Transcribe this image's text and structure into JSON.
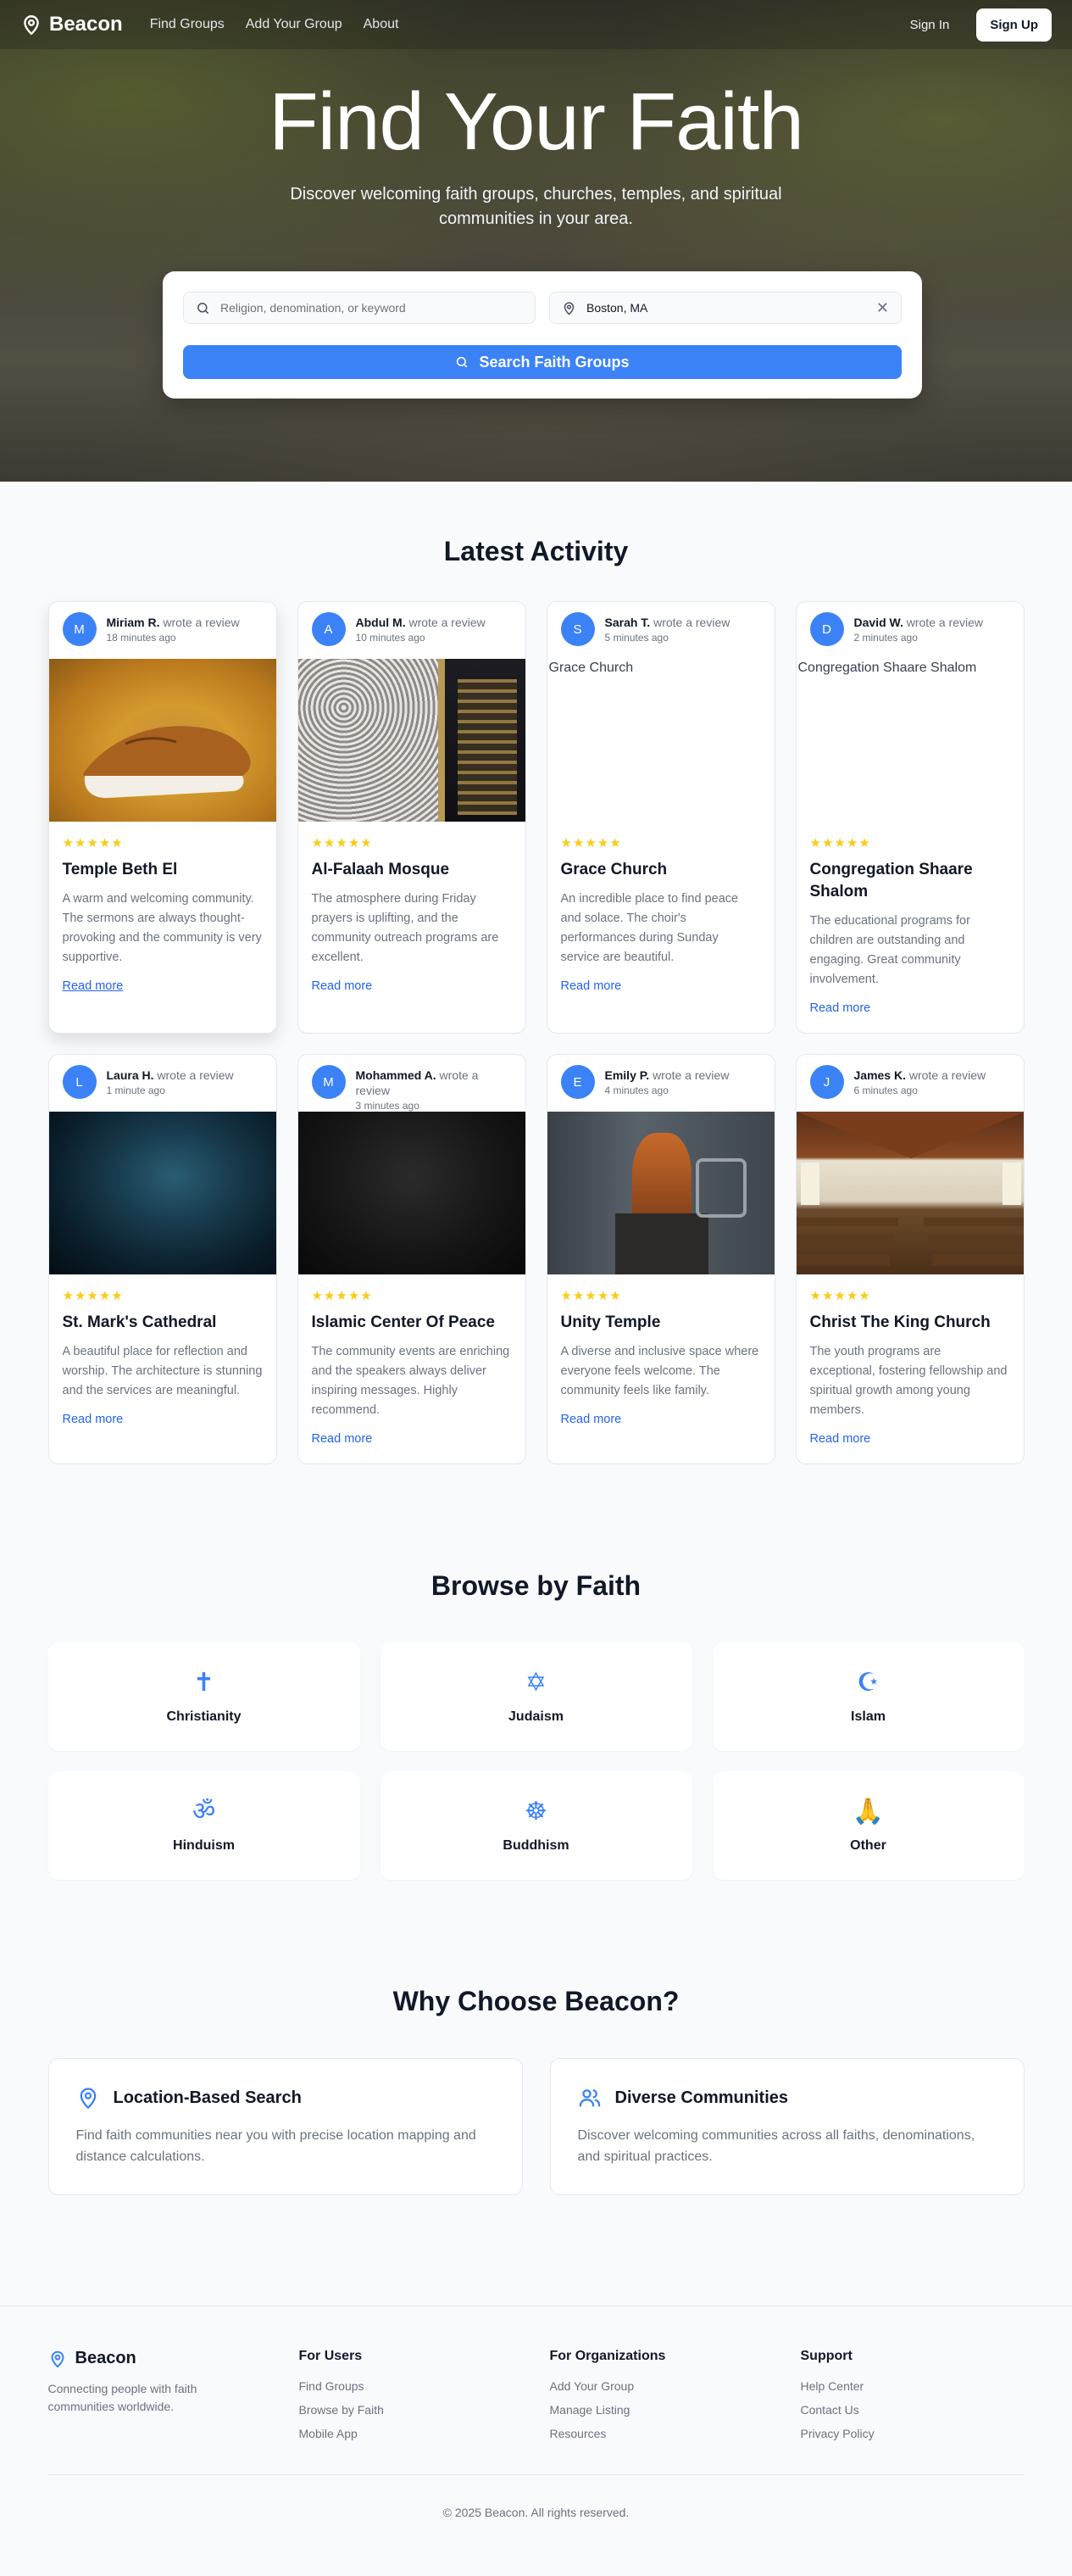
{
  "nav": {
    "brand": "Beacon",
    "links": [
      "Find Groups",
      "Add Your Group",
      "About"
    ],
    "sign_in": "Sign In",
    "sign_up": "Sign Up"
  },
  "hero": {
    "title": "Find Your Faith",
    "subtitle": "Discover welcoming faith groups, churches, temples, and spiritual communities in your area.",
    "keyword_placeholder": "Religion, denomination, or keyword",
    "location_value": "Boston, MA",
    "search_button": "Search Faith Groups"
  },
  "activity": {
    "title": "Latest Activity",
    "cards": [
      {
        "initial": "M",
        "user": "Miriam R.",
        "action": "wrote a review",
        "time": "18 minutes ago",
        "stars": "★★★★★",
        "name": "Temple Beth El",
        "text": "A warm and welcoming community. The sermons are always thought-provoking and the community is very supportive.",
        "link": "Read more",
        "img_alt": ""
      },
      {
        "initial": "A",
        "user": "Abdul M.",
        "action": "wrote a review",
        "time": "10 minutes ago",
        "stars": "★★★★★",
        "name": "Al-Falaah Mosque",
        "text": "The atmosphere during Friday prayers is uplifting, and the community outreach programs are excellent.",
        "link": "Read more",
        "img_alt": ""
      },
      {
        "initial": "S",
        "user": "Sarah T.",
        "action": "wrote a review",
        "time": "5 minutes ago",
        "stars": "★★★★★",
        "name": "Grace Church",
        "text": "An incredible place to find peace and solace. The choir's performances during Sunday service are beautiful.",
        "link": "Read more",
        "img_alt": "Grace Church"
      },
      {
        "initial": "D",
        "user": "David W.",
        "action": "wrote a review",
        "time": "2 minutes ago",
        "stars": "★★★★★",
        "name": "Congregation Shaare Shalom",
        "text": "The educational programs for children are outstanding and engaging. Great community involvement.",
        "link": "Read more",
        "img_alt": "Congregation Shaare Shalom"
      },
      {
        "initial": "L",
        "user": "Laura H.",
        "action": "wrote a review",
        "time": "1 minute ago",
        "stars": "★★★★★",
        "name": "St. Mark's Cathedral",
        "text": "A beautiful place for reflection and worship. The architecture is stunning and the services are meaningful.",
        "link": "Read more",
        "img_alt": ""
      },
      {
        "initial": "M",
        "user": "Mohammed A.",
        "action": "wrote a review",
        "time": "3 minutes ago",
        "stars": "★★★★★",
        "name": "Islamic Center Of Peace",
        "text": "The community events are enriching and the speakers always deliver inspiring messages. Highly recommend.",
        "link": "Read more",
        "img_alt": ""
      },
      {
        "initial": "E",
        "user": "Emily P.",
        "action": "wrote a review",
        "time": "4 minutes ago",
        "stars": "★★★★★",
        "name": "Unity Temple",
        "text": "A diverse and inclusive space where everyone feels welcome. The community feels like family.",
        "link": "Read more",
        "img_alt": ""
      },
      {
        "initial": "J",
        "user": "James K.",
        "action": "wrote a review",
        "time": "6 minutes ago",
        "stars": "★★★★★",
        "name": "Christ The King Church",
        "text": "The youth programs are exceptional, fostering fellowship and spiritual growth among young members.",
        "link": "Read more",
        "img_alt": ""
      }
    ]
  },
  "faith": {
    "title": "Browse by Faith",
    "items": [
      {
        "label": "Christianity",
        "icon": "✝",
        "icon_name": "cross-icon"
      },
      {
        "label": "Judaism",
        "icon": "✡",
        "icon_name": "star-of-david-icon"
      },
      {
        "label": "Islam",
        "icon": "☪",
        "icon_name": "crescent-icon"
      },
      {
        "label": "Hinduism",
        "icon": "ॐ",
        "icon_name": "om-icon"
      },
      {
        "label": "Buddhism",
        "icon": "☸",
        "icon_name": "dharma-wheel-icon"
      },
      {
        "label": "Other",
        "icon": "🙏",
        "icon_name": "praying-hands-icon"
      }
    ]
  },
  "why": {
    "title": "Why Choose Beacon?",
    "features": [
      {
        "title": "Location-Based Search",
        "text": "Find faith communities near you with precise location mapping and distance calculations.",
        "icon": "map-pin-icon"
      },
      {
        "title": "Diverse Communities",
        "text": "Discover welcoming communities across all faiths, denominations, and spiritual practices.",
        "icon": "users-icon"
      }
    ]
  },
  "footer": {
    "brand": "Beacon",
    "tagline": "Connecting people with faith communities worldwide.",
    "columns": [
      {
        "heading": "For Users",
        "links": [
          "Find Groups",
          "Browse by Faith",
          "Mobile App"
        ]
      },
      {
        "heading": "For Organizations",
        "links": [
          "Add Your Group",
          "Manage Listing",
          "Resources"
        ]
      },
      {
        "heading": "Support",
        "links": [
          "Help Center",
          "Contact Us",
          "Privacy Policy"
        ]
      }
    ],
    "copyright": "© 2025 Beacon. All rights reserved."
  },
  "colors": {
    "accent": "#3b82f6",
    "star": "#facc15",
    "muted": "#6b7280"
  }
}
